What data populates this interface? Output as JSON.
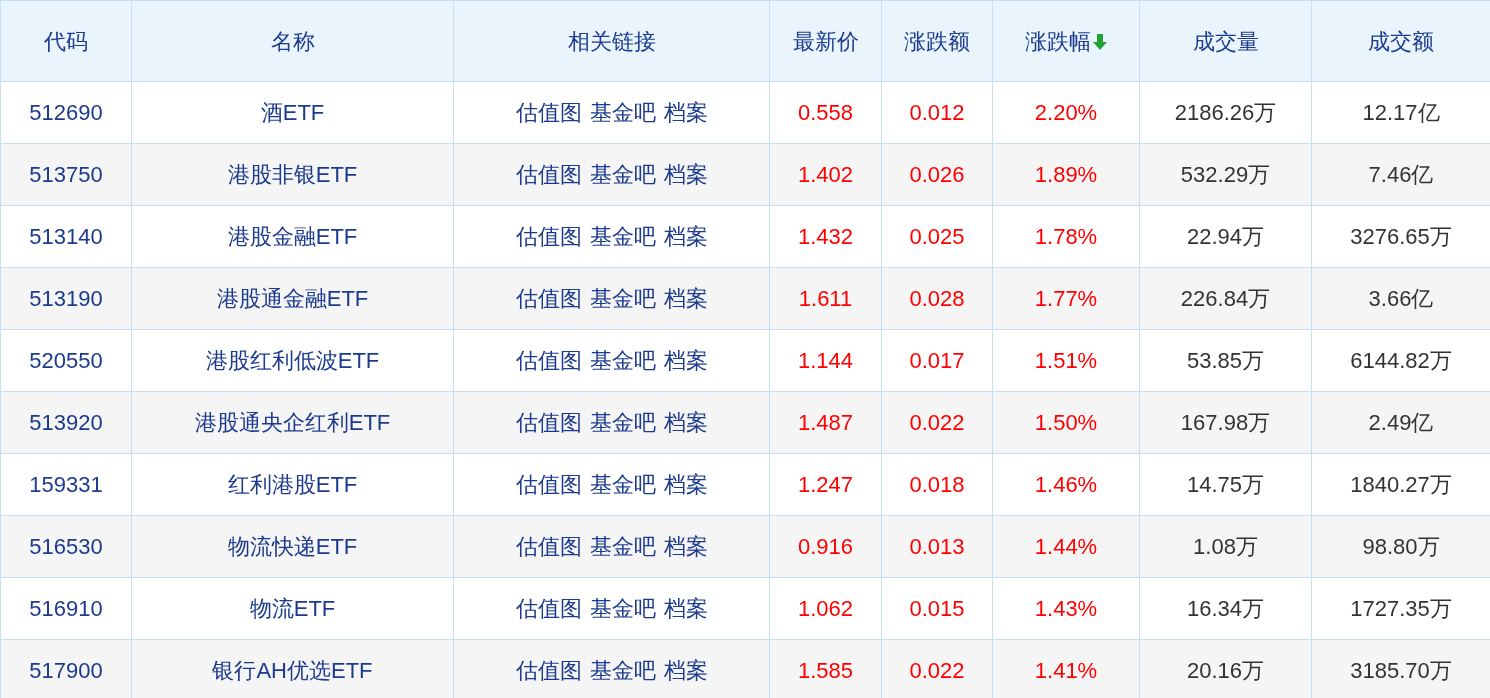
{
  "table": {
    "columns": [
      {
        "label": "代码",
        "sorted": false
      },
      {
        "label": "名称",
        "sorted": false
      },
      {
        "label": "相关链接",
        "sorted": false
      },
      {
        "label": "最新价",
        "sorted": false
      },
      {
        "label": "涨跌额",
        "sorted": false
      },
      {
        "label": "涨跌幅",
        "sorted": true
      },
      {
        "label": "成交量",
        "sorted": false
      },
      {
        "label": "成交额",
        "sorted": false
      }
    ],
    "rows": [
      {
        "code": "512690",
        "name": "酒ETF",
        "links": [
          "估值图",
          "基金吧",
          "档案"
        ],
        "price": "0.558",
        "change": "0.012",
        "pct": "2.20%",
        "volume": "2186.26万",
        "amount": "12.17亿",
        "rising": true
      },
      {
        "code": "513750",
        "name": "港股非银ETF",
        "links": [
          "估值图",
          "基金吧",
          "档案"
        ],
        "price": "1.402",
        "change": "0.026",
        "pct": "1.89%",
        "volume": "532.29万",
        "amount": "7.46亿",
        "rising": true
      },
      {
        "code": "513140",
        "name": "港股金融ETF",
        "links": [
          "估值图",
          "基金吧",
          "档案"
        ],
        "price": "1.432",
        "change": "0.025",
        "pct": "1.78%",
        "volume": "22.94万",
        "amount": "3276.65万",
        "rising": true
      },
      {
        "code": "513190",
        "name": "港股通金融ETF",
        "links": [
          "估值图",
          "基金吧",
          "档案"
        ],
        "price": "1.611",
        "change": "0.028",
        "pct": "1.77%",
        "volume": "226.84万",
        "amount": "3.66亿",
        "rising": true
      },
      {
        "code": "520550",
        "name": "港股红利低波ETF",
        "links": [
          "估值图",
          "基金吧",
          "档案"
        ],
        "price": "1.144",
        "change": "0.017",
        "pct": "1.51%",
        "volume": "53.85万",
        "amount": "6144.82万",
        "rising": true
      },
      {
        "code": "513920",
        "name": "港股通央企红利ETF",
        "links": [
          "估值图",
          "基金吧",
          "档案"
        ],
        "price": "1.487",
        "change": "0.022",
        "pct": "1.50%",
        "volume": "167.98万",
        "amount": "2.49亿",
        "rising": true
      },
      {
        "code": "159331",
        "name": "红利港股ETF",
        "links": [
          "估值图",
          "基金吧",
          "档案"
        ],
        "price": "1.247",
        "change": "0.018",
        "pct": "1.46%",
        "volume": "14.75万",
        "amount": "1840.27万",
        "rising": true
      },
      {
        "code": "516530",
        "name": "物流快递ETF",
        "links": [
          "估值图",
          "基金吧",
          "档案"
        ],
        "price": "0.916",
        "change": "0.013",
        "pct": "1.44%",
        "volume": "1.08万",
        "amount": "98.80万",
        "rising": true
      },
      {
        "code": "516910",
        "name": "物流ETF",
        "links": [
          "估值图",
          "基金吧",
          "档案"
        ],
        "price": "1.062",
        "change": "0.015",
        "pct": "1.43%",
        "volume": "16.34万",
        "amount": "1727.35万",
        "rising": true
      },
      {
        "code": "517900",
        "name": "银行AH优选ETF",
        "links": [
          "估值图",
          "基金吧",
          "档案"
        ],
        "price": "1.585",
        "change": "0.022",
        "pct": "1.41%",
        "volume": "20.16万",
        "amount": "3185.70万",
        "rising": true
      }
    ]
  }
}
